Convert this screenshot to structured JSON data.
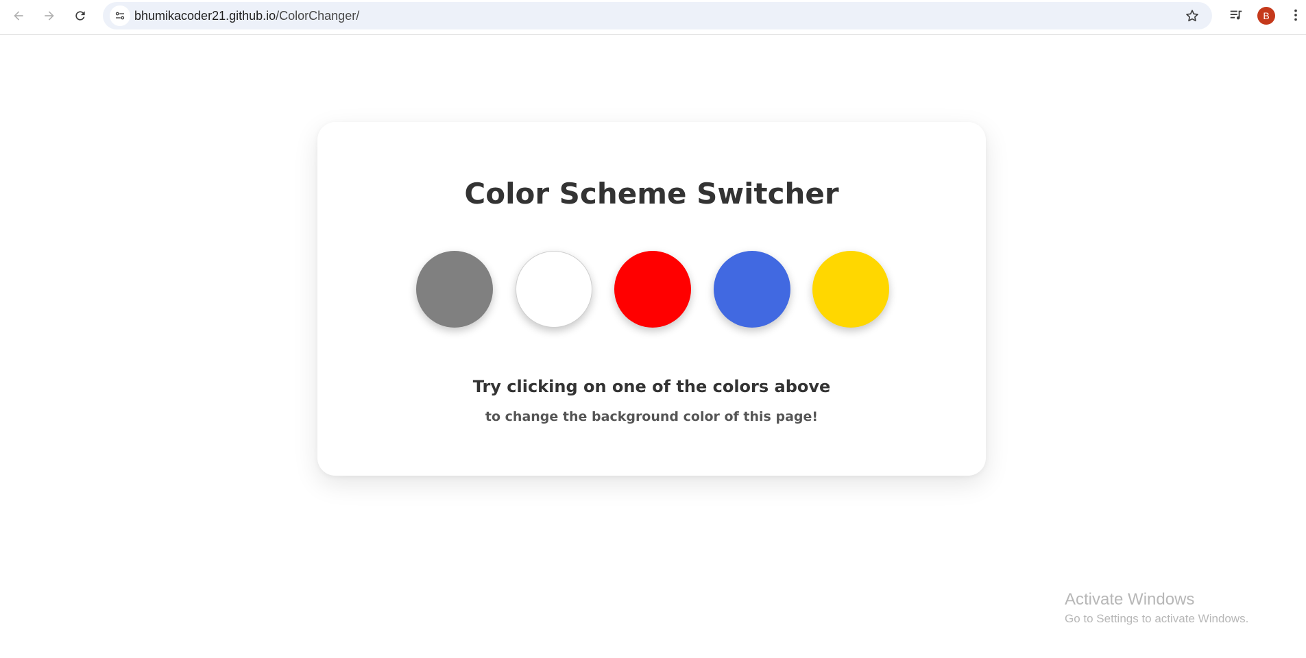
{
  "browser": {
    "url_host": "bhumikacoder21.github.io",
    "url_path": "/ColorChanger/",
    "profile_initial": "B",
    "icons": {
      "back": "back-arrow-icon",
      "forward": "forward-arrow-icon",
      "reload": "reload-icon",
      "site_info": "site-settings-icon",
      "bookmark": "star-icon",
      "media": "media-playlist-icon",
      "menu": "kebab-menu-icon"
    }
  },
  "card": {
    "title": "Color Scheme Switcher",
    "hint_main": "Try clicking on one of the colors above",
    "hint_sub": "to change the background color of this page!"
  },
  "swatches": [
    {
      "name": "grey",
      "color": "#808080"
    },
    {
      "name": "white",
      "color": "#ffffff"
    },
    {
      "name": "red",
      "color": "#ff0000"
    },
    {
      "name": "blue",
      "color": "#4169e1"
    },
    {
      "name": "yellow",
      "color": "#ffd700"
    }
  ],
  "watermark": {
    "title": "Activate Windows",
    "subtitle": "Go to Settings to activate Windows."
  }
}
